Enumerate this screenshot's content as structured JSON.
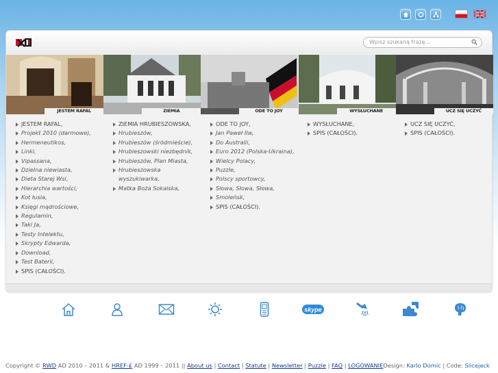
{
  "top_nav": {
    "icons": [
      "home-icon",
      "recycle-icon",
      "sitemap-icon"
    ],
    "languages": [
      "polish-flag-icon",
      "english-flag-icon"
    ]
  },
  "header": {
    "logo_text": "R",
    "search_placeholder": "Wpisz szukaną frazę..."
  },
  "sections": [
    {
      "caption": "JESTEM RAFAL",
      "items": [
        "JESTEM RAFAL,",
        "Projekt 2010 (darmowe),",
        "Hermeneutikos,",
        "Linki,",
        "Vipassana,",
        "Dzielna niewiasta,",
        "Dieta Starej Wsi,",
        "Hierarchia wartości,",
        "Kot łusia,",
        "Księgi mądrościowe,",
        "Regulamin,",
        "Taki Ja,",
        "Testy Intelektu,",
        "Skrypty Edwarda,",
        "Download,",
        "Test Baterii,",
        "SPIS (CAŁOŚCI)."
      ]
    },
    {
      "caption": "ZIEMIA HRUBIESZOWSKA",
      "items": [
        "ZIEMIA HRUBIESZOWSKA,",
        "Hrubieszów,",
        "Hrubieszów (śródmieście),",
        "Hrubieszowski niezbędnik,",
        "Hrubieszów, Plan Miasta,",
        "Hrubieszowska",
        "Matka Boża Sokalska,"
      ],
      "wrap_item": "wyszukiwarka,"
    },
    {
      "caption": "ODE TO JOY",
      "items": [
        "ODE TO JOY,",
        "Jan Paweł IIw,",
        "Do Australii,",
        "Euro 2012 (Polska-Ukraina),",
        "Wielcy Polacy,",
        "Puzzle,",
        "Polscy sportowcy,",
        "Słowa, Słowa, Słowa,",
        "Smoleńsk,",
        "SPIS (CAŁOŚCI)."
      ]
    },
    {
      "caption": "WYSŁUCHANE",
      "items": [
        "WYSŁUCHANE,",
        "SPIS (CAŁOŚCI)."
      ]
    },
    {
      "caption": "UCZ SIĘ UCZYĆ",
      "items": [
        "UCZ SIĘ UCZYĆ,",
        "SPIS (CAŁOŚCI)."
      ]
    }
  ],
  "bottom_icons": [
    "home-icon",
    "user-icon",
    "mail-icon",
    "sun-icon",
    "phone-icon",
    "skype-icon",
    "shower-icon",
    "puzzle-icon",
    "brain-icon"
  ],
  "bottom_texts": {
    "skype": "skype"
  },
  "footer": {
    "copy1": "Copyright © ",
    "rwd": "RWD",
    "copy2": " AD 2010 – 2011 & ",
    "href": "HREF-£",
    "copy3": " AD 1999 – 2011  ||  ",
    "links": [
      "About us",
      "Contact",
      "Statute",
      "Newsletter",
      "Puzzle",
      "FAQ",
      "LOGOWANIE"
    ],
    "sep": " | ",
    "design_label": "Design: ",
    "designer": "Karlo Domic",
    "code_label": " | Code: ",
    "coder": "Slicejack"
  },
  "colors": {
    "accent": "#4f9bd3",
    "link": "#123a8a",
    "pl_red": "#d3132f"
  }
}
